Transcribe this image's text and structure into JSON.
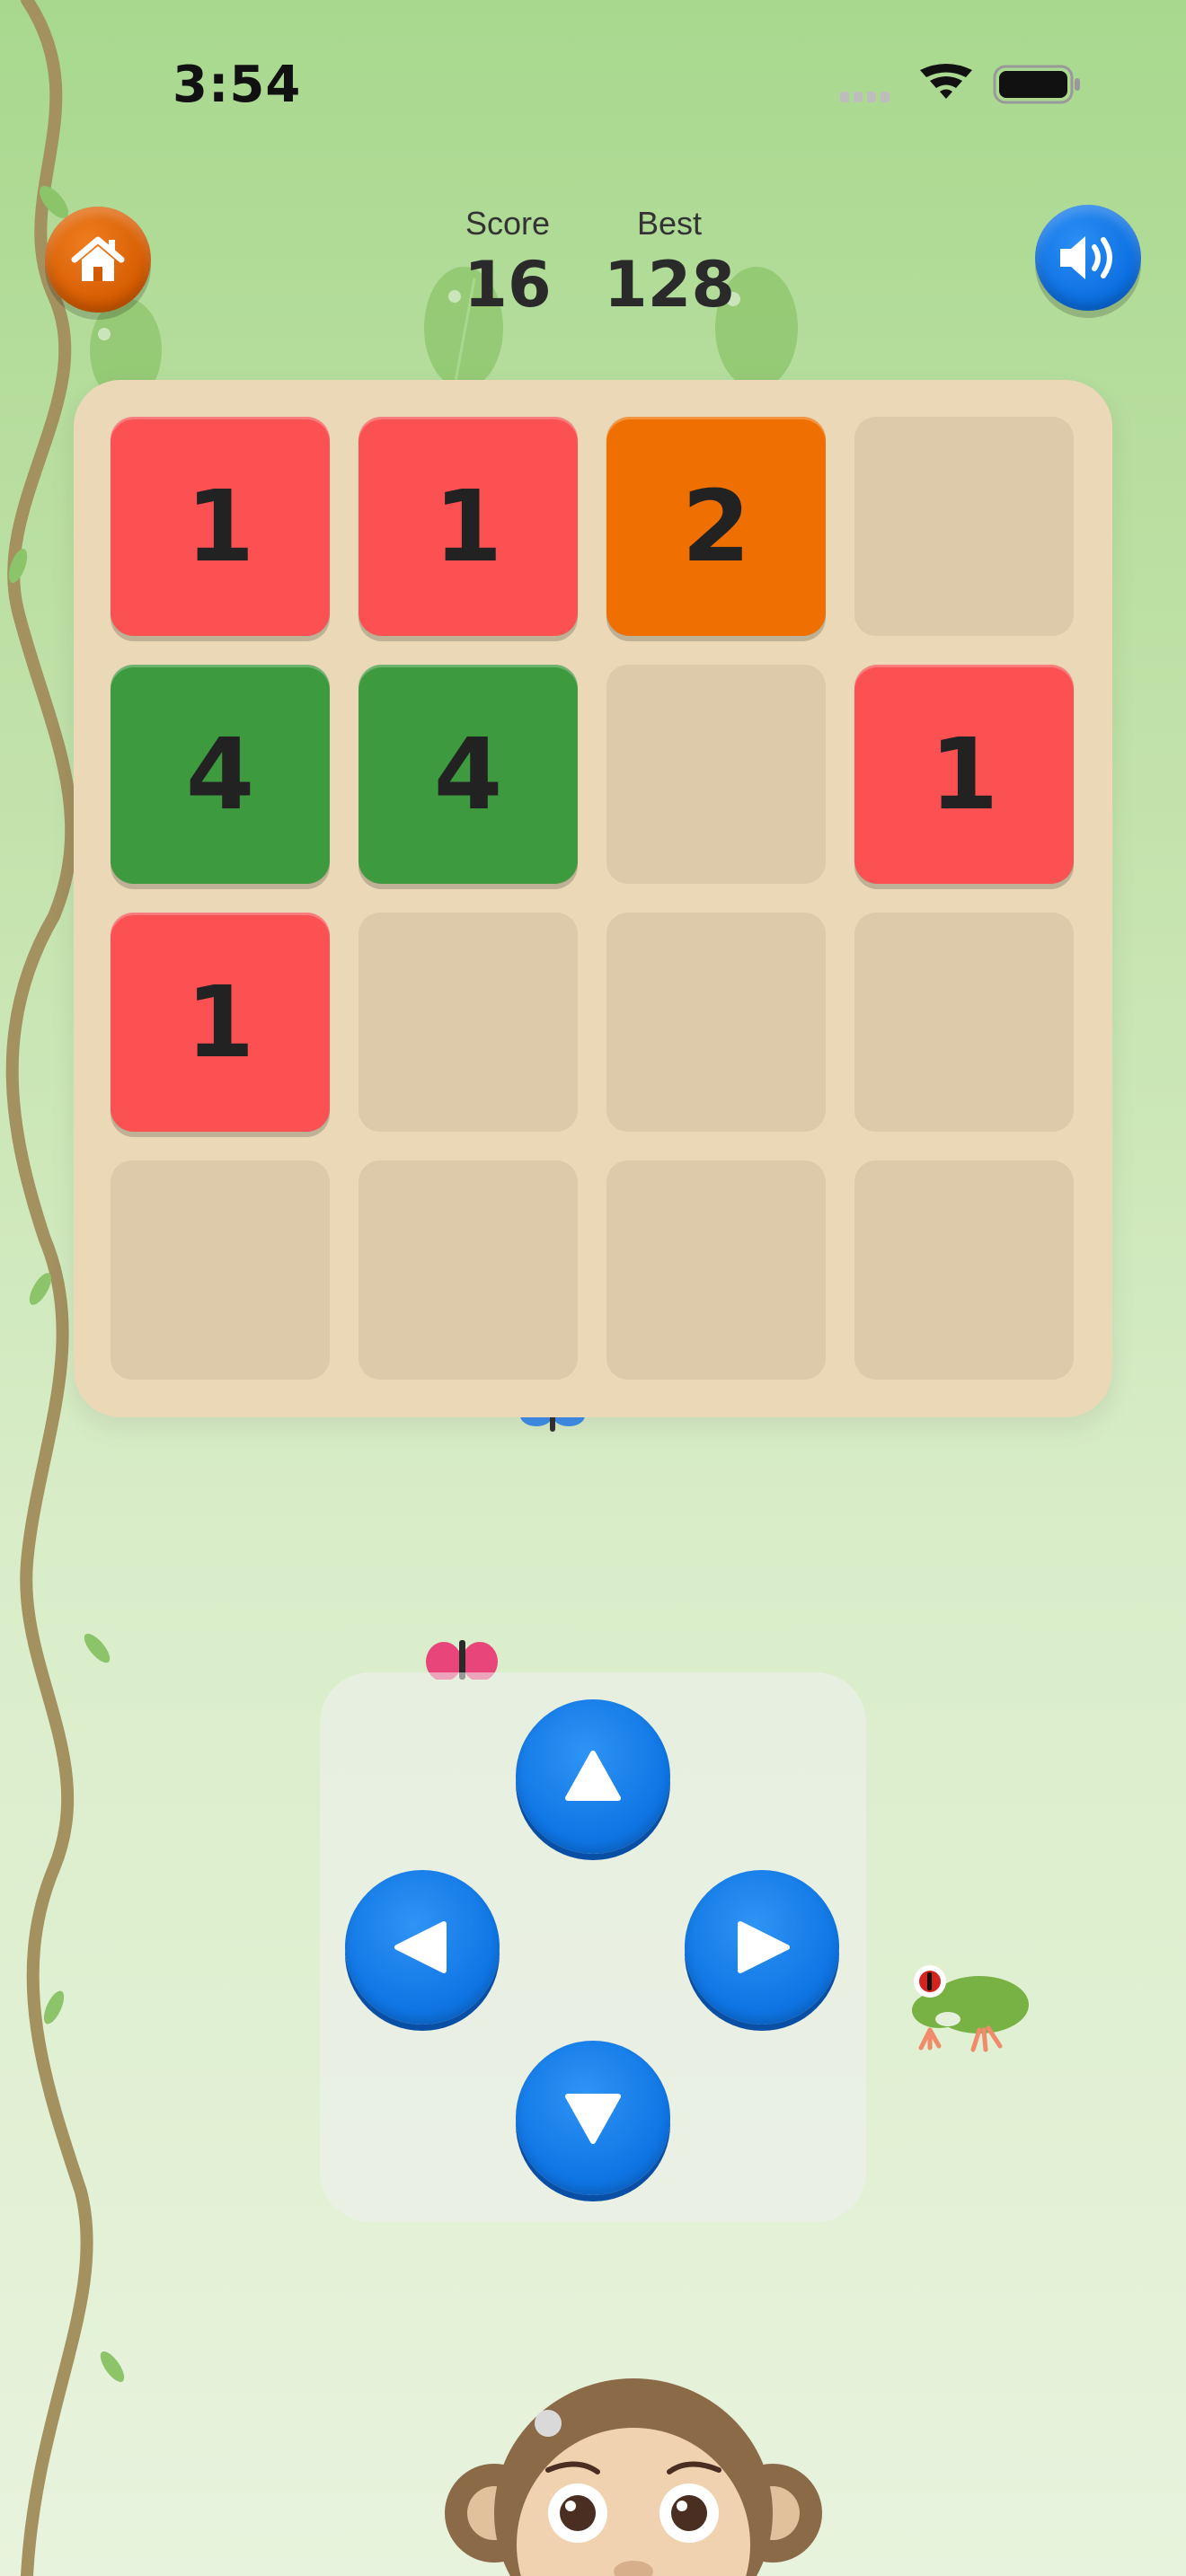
{
  "status_bar": {
    "time": "3:54",
    "icons": [
      "signal-icon",
      "wifi-icon",
      "battery-icon"
    ]
  },
  "header": {
    "home_icon": "home-icon",
    "sound_icon": "speaker-icon",
    "score_label": "Score",
    "score_value": "16",
    "best_label": "Best",
    "best_value": "128"
  },
  "board": {
    "rows": [
      [
        "1",
        "1",
        "2",
        ""
      ],
      [
        "4",
        "4",
        "",
        "1"
      ],
      [
        "1",
        "",
        "",
        ""
      ],
      [
        "",
        "",
        "",
        ""
      ]
    ]
  },
  "tile_colors": {
    "1": "#fb5152",
    "2": "#ef7000",
    "4": "#3d9a3f"
  },
  "controls": {
    "up_icon": "arrow-up-icon",
    "left_icon": "arrow-left-icon",
    "right_icon": "arrow-right-icon",
    "down_icon": "arrow-down-icon"
  },
  "colors": {
    "board": "#ead8b7",
    "empty_cell": "#dccaaa",
    "home_button": "#d45a00",
    "sound_button": "#0a6de0",
    "arrow_button": "#0f75e4"
  }
}
